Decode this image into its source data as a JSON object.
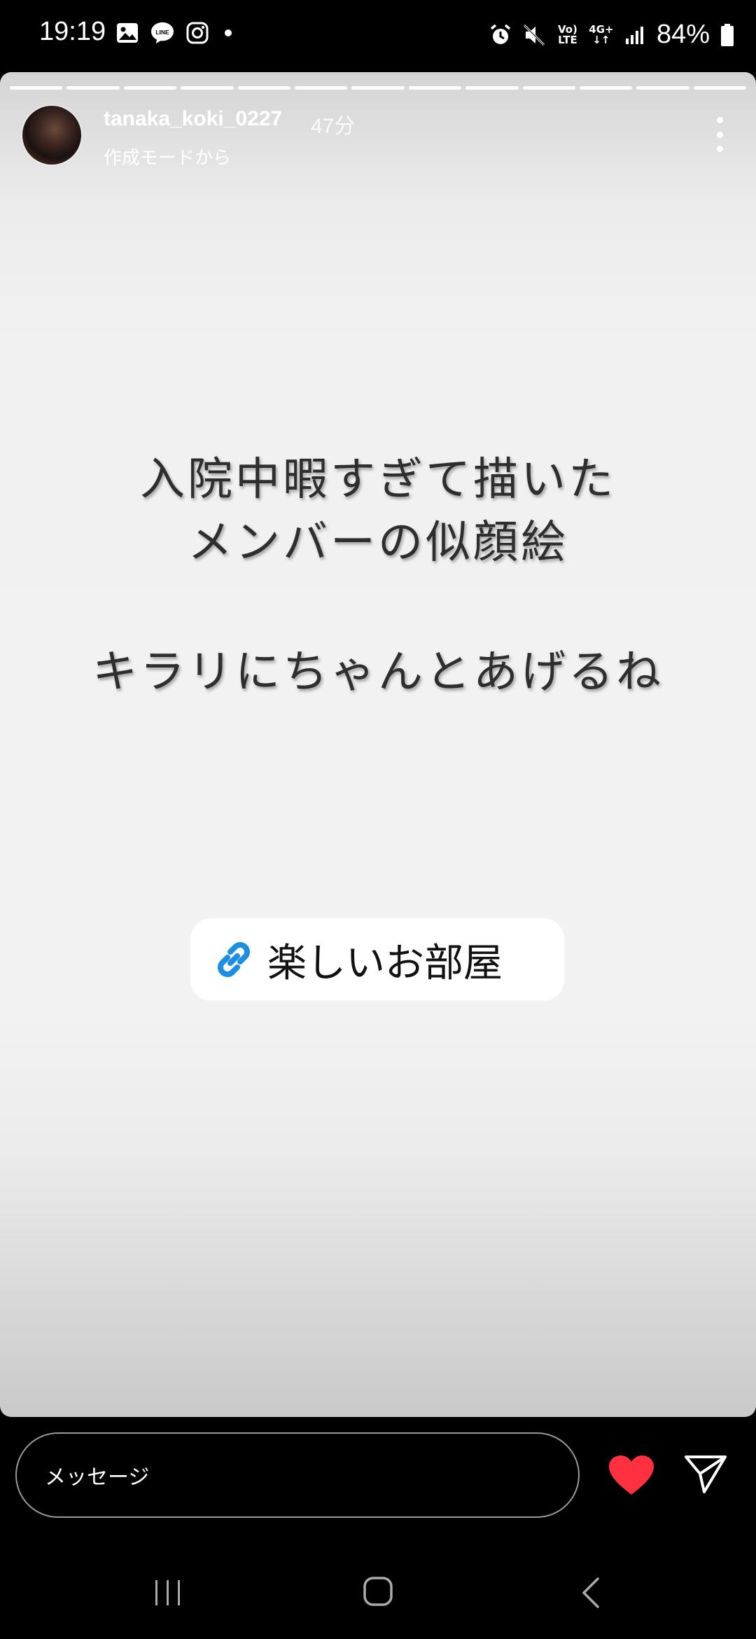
{
  "status_bar": {
    "time": "19:19",
    "battery": "84%",
    "left_icons": [
      "gallery-icon",
      "line-app-icon",
      "instagram-icon",
      "notification-dot"
    ],
    "right_icons": [
      "alarm-icon",
      "mute-icon",
      "volte-icon",
      "4g-data-icon",
      "signal-icon",
      "battery-icon"
    ],
    "volte_top": "Vo)",
    "volte_bottom": "LTE",
    "net_type": "4G+"
  },
  "story": {
    "progress_segments": 13,
    "username": "tanaka_koki_0227",
    "time_ago": "47分",
    "subtitle": "作成モードから",
    "text_lines": [
      "入院中暇すぎて描いた",
      "メンバーの似顔絵",
      "キラリにちゃんとあげるね"
    ],
    "link_sticker_label": "楽しいお部屋",
    "link_color": "#1c8fe0"
  },
  "reply": {
    "placeholder": "メッセージ",
    "heart_color": "#ff3040"
  },
  "nav": {
    "buttons": [
      "recent-apps",
      "home",
      "back"
    ]
  }
}
